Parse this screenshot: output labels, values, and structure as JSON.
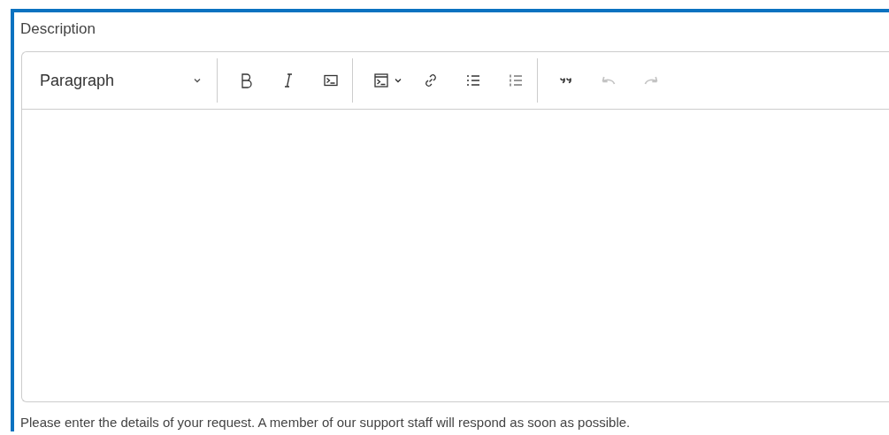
{
  "label": "Description",
  "toolbar": {
    "block_format": "Paragraph",
    "groups": [
      [
        {
          "kind": "bold",
          "disabled": false
        },
        {
          "kind": "italic",
          "disabled": false
        },
        {
          "kind": "code",
          "disabled": false
        }
      ],
      [
        {
          "kind": "code-block",
          "disabled": false
        },
        {
          "kind": "dropdown",
          "disabled": false
        },
        {
          "kind": "link",
          "disabled": false
        },
        {
          "kind": "bullet-list",
          "disabled": false
        },
        {
          "kind": "numbered-list",
          "disabled": false
        }
      ],
      [
        {
          "kind": "quote",
          "disabled": false
        },
        {
          "kind": "undo",
          "disabled": true
        },
        {
          "kind": "redo",
          "disabled": true
        }
      ]
    ]
  },
  "hint": "Please enter the details of your request. A member of our support staff will respond as soon as possible."
}
